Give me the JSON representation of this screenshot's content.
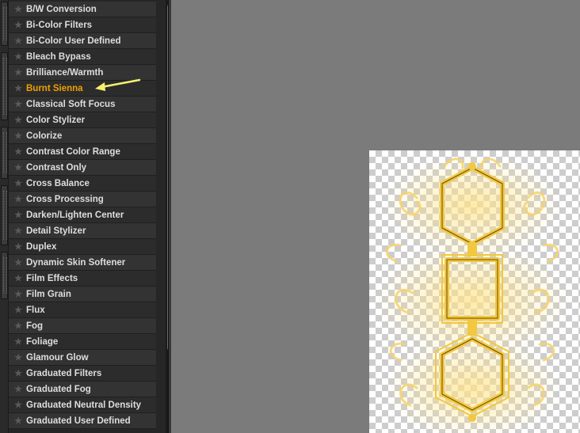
{
  "filters": {
    "items": [
      {
        "label": "B/W Conversion"
      },
      {
        "label": "Bi-Color Filters"
      },
      {
        "label": "Bi-Color User Defined"
      },
      {
        "label": "Bleach Bypass"
      },
      {
        "label": "Brilliance/Warmth"
      },
      {
        "label": "Burnt Sienna",
        "selected": true
      },
      {
        "label": "Classical Soft Focus"
      },
      {
        "label": "Color Stylizer"
      },
      {
        "label": "Colorize"
      },
      {
        "label": "Contrast Color Range"
      },
      {
        "label": "Contrast Only"
      },
      {
        "label": "Cross Balance"
      },
      {
        "label": "Cross Processing"
      },
      {
        "label": "Darken/Lighten Center"
      },
      {
        "label": "Detail Stylizer"
      },
      {
        "label": "Duplex"
      },
      {
        "label": "Dynamic Skin Softener"
      },
      {
        "label": "Film Effects"
      },
      {
        "label": "Film Grain"
      },
      {
        "label": "Flux"
      },
      {
        "label": "Fog"
      },
      {
        "label": "Foliage"
      },
      {
        "label": "Glamour Glow"
      },
      {
        "label": "Graduated Filters"
      },
      {
        "label": "Graduated Fog"
      },
      {
        "label": "Graduated Neutral Density"
      },
      {
        "label": "Graduated User Defined"
      }
    ],
    "star_icon": "star-icon",
    "selected_color": "#f0a000"
  },
  "annotation": {
    "icon": "arrow-left-icon",
    "color": "#f5f070"
  },
  "canvas": {
    "ornament_color": "#f2c840"
  }
}
